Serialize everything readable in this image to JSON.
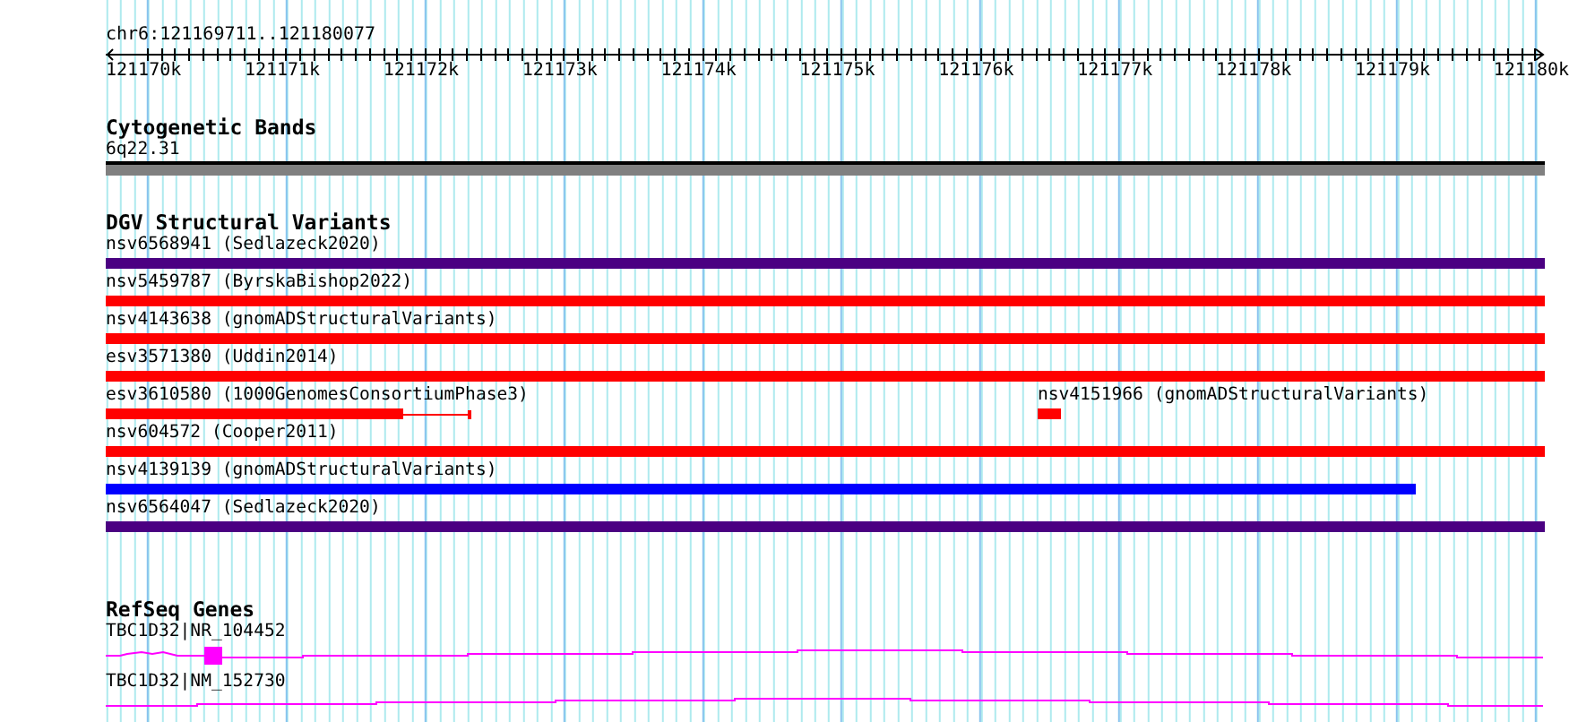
{
  "location": "chr6:121169711..121180077",
  "ruler": {
    "labels": [
      "121170k",
      "121171k",
      "121172k",
      "121173k",
      "121174k",
      "121175k",
      "121176k",
      "121177k",
      "121178k",
      "121179k",
      "121180k"
    ]
  },
  "tracks": [
    {
      "title": "Cytogenetic Bands",
      "kind": "bands",
      "features": [
        {
          "label": "6q22.31"
        }
      ]
    },
    {
      "title": "DGV Structural Variants",
      "kind": "variants",
      "rows": [
        [
          {
            "label": "nsv6568941 (Sedlazeck2020)",
            "color": "#4b0082",
            "kind": "full"
          }
        ],
        [
          {
            "label": "nsv5459787 (ByrskaBishop2022)",
            "color": "#ff0000",
            "kind": "full"
          }
        ],
        [
          {
            "label": "nsv4143638 (gnomADStructuralVariants)",
            "color": "#ff0000",
            "kind": "full"
          }
        ],
        [
          {
            "label": "esv3571380 (Uddin2014)",
            "color": "#ff0000",
            "kind": "full"
          }
        ],
        [
          {
            "label": "esv3610580 (1000GenomesConsortiumPhase3)",
            "color": "#ff0000",
            "kind": "whisker"
          },
          {
            "label": "nsv4151966 (gnomADStructuralVariants)",
            "color": "#ff0000",
            "kind": "small"
          }
        ],
        [
          {
            "label": "nsv604572 (Cooper2011)",
            "color": "#ff0000",
            "kind": "full"
          }
        ],
        [
          {
            "label": "nsv4139139 (gnomADStructuralVariants)",
            "color": "#0000ff",
            "kind": "partial",
            "level": 0.91
          }
        ],
        [
          {
            "label": "nsv6564047 (Sedlazeck2020)",
            "color": "#4b0082",
            "kind": "full"
          }
        ]
      ]
    },
    {
      "title": "RefSeq Genes",
      "kind": "genes",
      "features": [
        {
          "label": "TBC1D32|NR_104452",
          "kind": "exon"
        },
        {
          "label": "TBC1D32|NM_152730",
          "kind": "line"
        }
      ]
    }
  ]
}
